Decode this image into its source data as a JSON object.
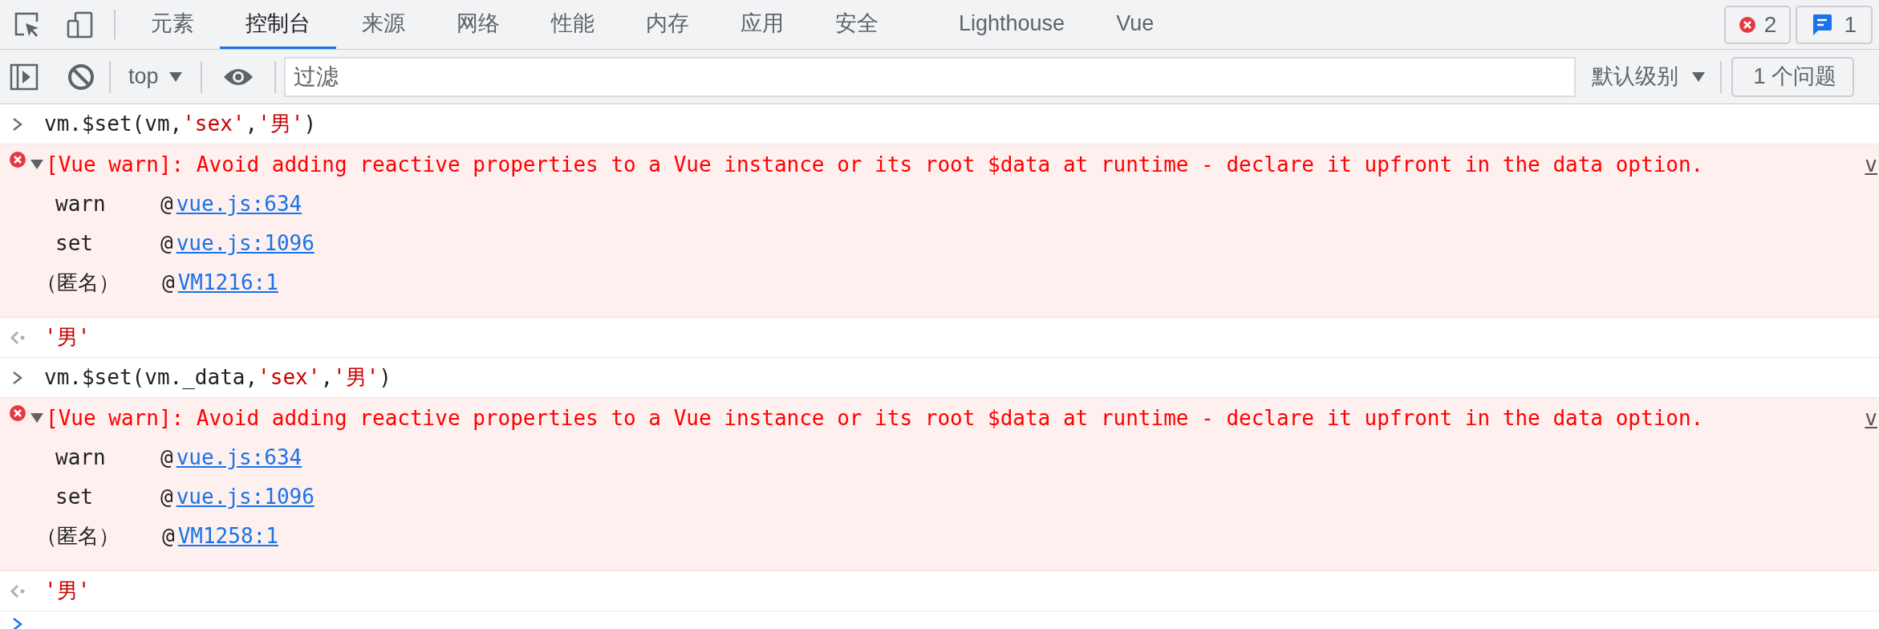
{
  "tabs": [
    {
      "label": "元素",
      "selected": false
    },
    {
      "label": "控制台",
      "selected": true
    },
    {
      "label": "来源",
      "selected": false
    },
    {
      "label": "网络",
      "selected": false
    },
    {
      "label": "性能",
      "selected": false
    },
    {
      "label": "内存",
      "selected": false
    },
    {
      "label": "应用",
      "selected": false
    },
    {
      "label": "安全",
      "selected": false
    },
    {
      "label": "Lighthouse",
      "selected": false
    },
    {
      "label": "Vue",
      "selected": false
    }
  ],
  "counters": {
    "errors": "2",
    "messages": "1"
  },
  "console_toolbar": {
    "context": "top",
    "filter": {
      "placeholder": "过滤"
    },
    "levels": "默认级别",
    "issues": "1 个问题"
  },
  "entries": [
    {
      "kind": "input",
      "parts": [
        {
          "kind": "code",
          "text": "vm.$set(vm,"
        },
        {
          "kind": "string",
          "text": "'sex'"
        },
        {
          "kind": "code",
          "text": ","
        },
        {
          "kind": "string",
          "text": "'男'"
        },
        {
          "kind": "code",
          "text": ")"
        }
      ]
    },
    {
      "kind": "error",
      "expanded": true,
      "message": "[Vue warn]: Avoid adding reactive properties to a Vue instance or its root $data at runtime - declare it upfront in the data option.",
      "source": "v",
      "frames": [
        {
          "name": "warn",
          "at": "@",
          "link": "vue.js:634"
        },
        {
          "name": "set",
          "at": "@",
          "link": "vue.js:1096"
        },
        {
          "name": "（匿名）",
          "at": "@",
          "link": "VM1216:1"
        }
      ]
    },
    {
      "kind": "result",
      "parts": [
        {
          "kind": "string",
          "text": "'男'"
        }
      ]
    },
    {
      "kind": "input",
      "parts": [
        {
          "kind": "code",
          "text": "vm.$set(vm._data,"
        },
        {
          "kind": "string",
          "text": "'sex'"
        },
        {
          "kind": "code",
          "text": ","
        },
        {
          "kind": "string",
          "text": "'男'"
        },
        {
          "kind": "code",
          "text": ")"
        }
      ]
    },
    {
      "kind": "error",
      "expanded": true,
      "message": "[Vue warn]: Avoid adding reactive properties to a Vue instance or its root $data at runtime - declare it upfront in the data option.",
      "source": "v",
      "frames": [
        {
          "name": "warn",
          "at": "@",
          "link": "vue.js:634"
        },
        {
          "name": "set",
          "at": "@",
          "link": "vue.js:1096"
        },
        {
          "name": "（匿名）",
          "at": "@",
          "link": "VM1258:1"
        }
      ]
    },
    {
      "kind": "result",
      "parts": [
        {
          "kind": "string",
          "text": "'男'"
        }
      ]
    },
    {
      "kind": "prompt"
    }
  ]
}
